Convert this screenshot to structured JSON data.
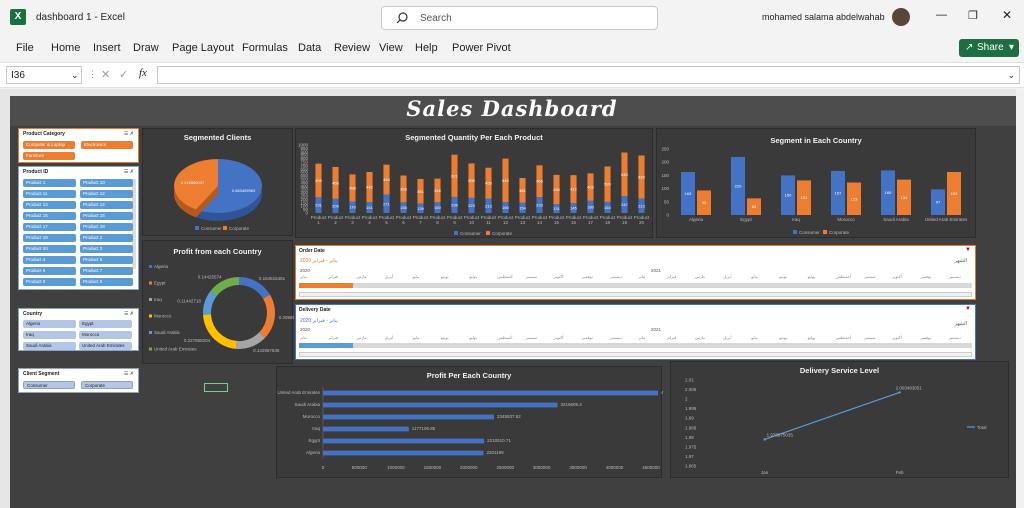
{
  "app": {
    "doc_title": "dashboard 1  -  Excel",
    "search_placeholder": "Search",
    "user_name": "mohamed salama abdelwahab",
    "share_label": "Share",
    "menu": [
      "File",
      "Home",
      "Insert",
      "Draw",
      "Page Layout",
      "Formulas",
      "Data",
      "Review",
      "View",
      "Help",
      "Power Pivot"
    ],
    "name_box": "I36",
    "fx_label": "fx"
  },
  "dashboard": {
    "title": "Sales Dashboard",
    "slicers": {
      "category": {
        "title": "Product Category",
        "items": [
          "Computer & Laptop",
          "Electronics",
          "Furniture"
        ]
      },
      "product": {
        "title": "Product ID",
        "items": [
          "Product 1",
          "Product 10",
          "Product 11",
          "Product 12",
          "Product 13",
          "Product 14",
          "Product 15",
          "Product 16",
          "Product 17",
          "Product 18",
          "Product 19",
          "Product 2",
          "Product 20",
          "Product 3",
          "Product 4",
          "Product 5",
          "Product 6",
          "Product 7",
          "Product 8",
          "Product 9"
        ]
      },
      "country": {
        "title": "Country",
        "items": [
          "Algeria",
          "Egypt",
          "Iraq",
          "Morocco",
          "Saudi Arabia",
          "United Arab Emirates"
        ]
      },
      "segment": {
        "title": "Client Segment",
        "items": [
          "Consumer",
          "Corporate"
        ]
      }
    },
    "timelines": {
      "order": {
        "title": "Order Date",
        "range": "يناير - فبراير 2020",
        "level": "الشهر",
        "year1": "2020",
        "year2": "2021",
        "months": [
          "يناير",
          "فبراير",
          "مارس",
          "أبريل",
          "مايو",
          "يونيو",
          "يوليو",
          "أغسطس",
          "سبتمبر",
          "أكتوبر",
          "نوفمبر",
          "ديسمبر",
          "يناير",
          "فبراير",
          "مارس",
          "أبريل",
          "مايو",
          "يونيو",
          "يوليو",
          "أغسطس",
          "سبتمبر",
          "أكتوبر",
          "نوفمبر",
          "ديسمبر"
        ]
      },
      "delivery": {
        "title": "Delivery Date",
        "range": "يناير - فبراير 2020",
        "level": "الشهر",
        "year1": "2020",
        "year2": "2021",
        "months": [
          "يناير",
          "فبراير",
          "مارس",
          "أبريل",
          "مايو",
          "يونيو",
          "يوليو",
          "أغسطس",
          "سبتمبر",
          "أكتوبر",
          "نوفمبر",
          "ديسمبر",
          "يناير",
          "فبراير",
          "مارس",
          "أبريل",
          "مايو",
          "يونيو",
          "يوليو",
          "أغسطس",
          "سبتمبر",
          "أكتوبر",
          "نوفمبر",
          "ديسمبر"
        ]
      }
    }
  },
  "colors": {
    "blue": "#4472c4",
    "orange": "#ed7d31",
    "gray": "#a5a5a5",
    "yellow": "#ffc000",
    "lightblue": "#5b9bd5",
    "green": "#70ad47",
    "excel_green": "#1d6f42"
  },
  "chart_data": [
    {
      "type": "pie",
      "title": "Segmented Clients",
      "categories": [
        "Consumer",
        "Corporate"
      ],
      "values": [
        0.583,
        0.417
      ],
      "labels": [
        "0.583409963",
        "0.416590037"
      ],
      "legend": "bottom"
    },
    {
      "type": "bar",
      "title": "Segmented Quantity Per Each Product",
      "stacked": true,
      "categories": [
        "Product 1",
        "Product 2",
        "Product 3",
        "Product 4",
        "Product 5",
        "Product 6",
        "Product 7",
        "Product 8",
        "Product 9",
        "Product 10",
        "Product 11",
        "Product 12",
        "Product 13",
        "Product 14",
        "Product 15",
        "Product 16",
        "Product 17",
        "Product 18",
        "Product 19",
        "Product 20"
      ],
      "series": [
        {
          "name": "Consumer",
          "values": [
            231,
            209,
            170,
            161,
            271,
            158,
            139,
            160,
            236,
            223,
            213,
            160,
            154,
            233,
            131,
            145,
            180,
            164,
            247,
            213
          ]
        },
        {
          "name": "Corporate",
          "values": [
            495,
            468,
            398,
            442,
            440,
            393,
            361,
            346,
            621,
            506,
            453,
            640,
            361,
            468,
            430,
            412,
            403,
            520,
            643,
            633
          ]
        }
      ],
      "ylim": [
        0,
        1000
      ],
      "yticks": [
        0,
        50,
        100,
        150,
        200,
        250,
        300,
        350,
        400,
        450,
        500,
        550,
        600,
        650,
        700,
        750,
        800,
        850,
        900,
        950,
        1000
      ],
      "legend": "bottom"
    },
    {
      "type": "bar",
      "title": "Segment in Each Country",
      "categories": [
        "Algeria",
        "Egypt",
        "Iraq",
        "Morocco",
        "Saudi Arabia",
        "United Arab Emirates"
      ],
      "series": [
        {
          "name": "Consumer",
          "values": [
            163,
            220,
            150,
            167,
            169,
            97
          ]
        },
        {
          "name": "Corporate",
          "values": [
            93,
            63,
            131,
            123,
            134,
            163
          ]
        }
      ],
      "ylim": [
        0,
        250
      ],
      "yticks": [
        0,
        50,
        100,
        150,
        200,
        250
      ],
      "legend": "bottom"
    },
    {
      "type": "pie",
      "title": "Profit from each Country",
      "donut": true,
      "categories": [
        "Algeria",
        "Egypt",
        "Iraq",
        "Morocco",
        "Saudi Arabia",
        "United Arab Emirates"
      ],
      "values": [
        0.165,
        0.206,
        0.143,
        0.228,
        0.114,
        0.144
      ],
      "labels": [
        "0.164515461",
        "0.205855845",
        "0.142987536",
        "0.227958204",
        "0.11442718",
        "0.14425574"
      ],
      "legend": "left"
    },
    {
      "type": "bar",
      "title": "Profit Per Each Country",
      "orientation": "horizontal",
      "categories": [
        "Algeria",
        "Egypt",
        "Iraq",
        "Morocco",
        "Saudi Arabia",
        "United Arab Emirates"
      ],
      "values": [
        2201199,
        2210510.71,
        1177106.85,
        2345937.82,
        3216609.4,
        4597023.6
      ],
      "labels": [
        "2201199",
        "2210510.71",
        "1177106.85",
        "2345937.82",
        "3216609.4",
        "4597023.6"
      ],
      "xlim": [
        0,
        4500000
      ],
      "xticks": [
        0,
        500000,
        1000000,
        1500000,
        2000000,
        2500000,
        3000000,
        3500000,
        4000000,
        4500000
      ]
    },
    {
      "type": "line",
      "title": "Delivery Service Level",
      "categories": [
        "Jan",
        "Feb"
      ],
      "series": [
        {
          "name": "Total",
          "values": [
            1.978875,
            2.003483
          ]
        }
      ],
      "labels": [
        "1.978875035",
        "2.003483051"
      ],
      "ylim": [
        1.965,
        2.01
      ],
      "yticks": [
        "1.965",
        "1.97",
        "1.975",
        "1.98",
        "1.985",
        "1.99",
        "1.995",
        "2",
        "2.005",
        "2.01"
      ],
      "legend": "right"
    }
  ]
}
